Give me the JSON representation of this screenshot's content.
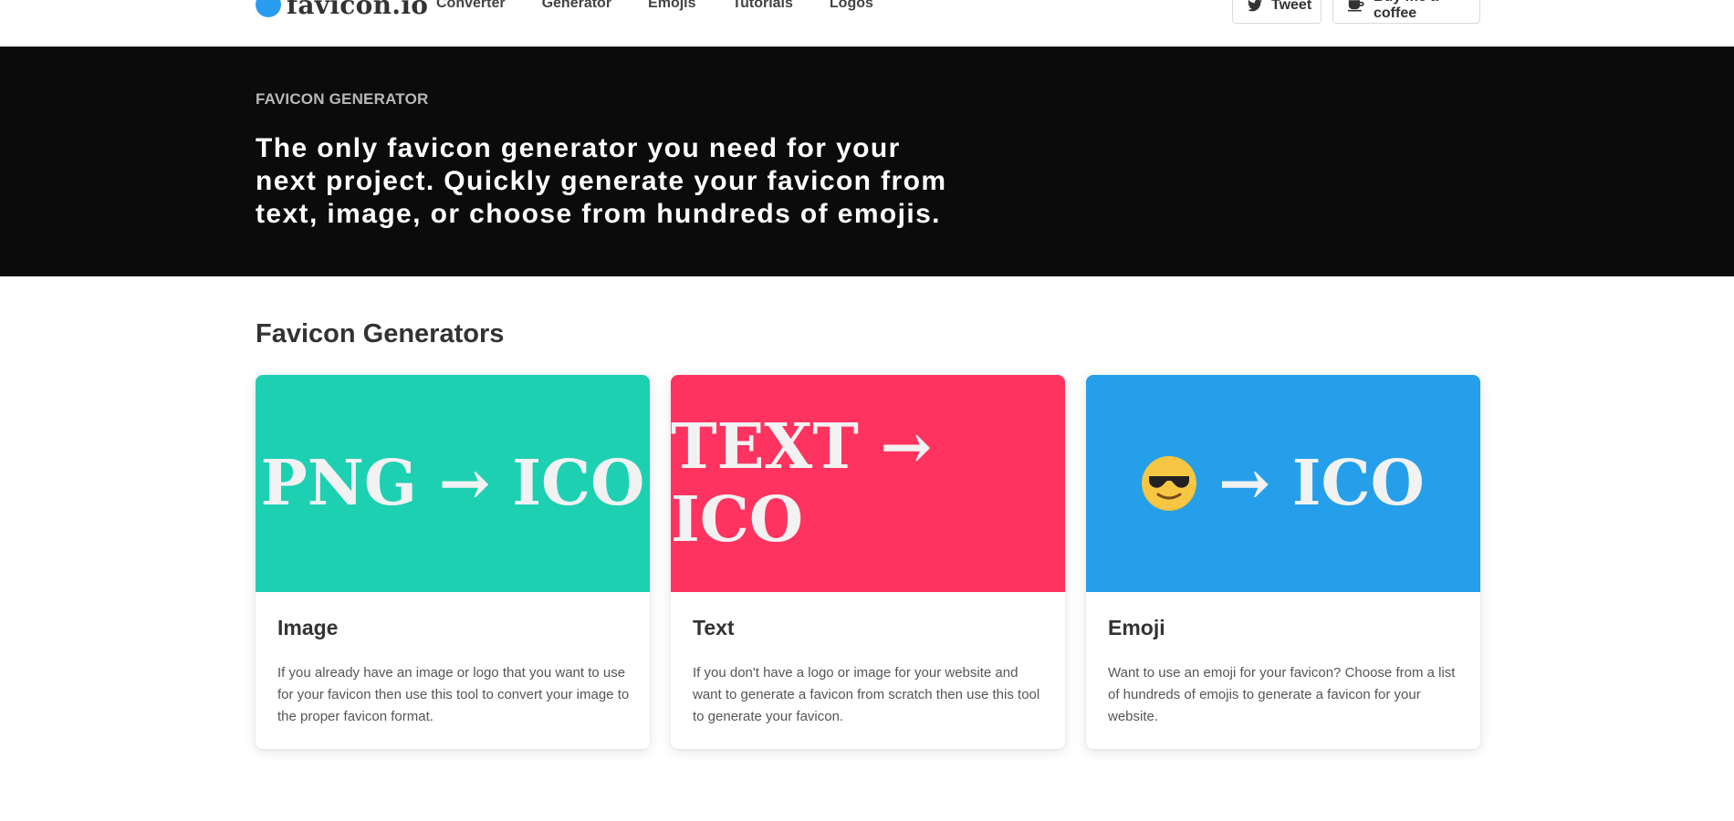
{
  "brand": {
    "name": "favicon.io",
    "color": "#2b9df0"
  },
  "nav": {
    "links": [
      "Converter",
      "Generator",
      "Emojis",
      "Tutorials",
      "Logos"
    ],
    "tweet_label": "Tweet",
    "coffee_label": "Buy me a coffee"
  },
  "hero": {
    "eyebrow": "FAVICON GENERATOR",
    "headline": "The only favicon generator you need for your next project. Quickly generate your favicon from text, image, or choose from hundreds of emojis."
  },
  "section": {
    "title": "Favicon Generators"
  },
  "cards": [
    {
      "image_text": "PNG → ICO",
      "color": "#1dd0b2",
      "title": "Image",
      "description": "If you already have an image or logo that you want to use for your favicon then use this tool to convert your image to the proper favicon format."
    },
    {
      "image_text": "TEXT → ICO",
      "color": "#fe335f",
      "title": "Text",
      "description": "If you don't have a logo or image for your website and want to generate a favicon from scratch then use this tool to generate your favicon."
    },
    {
      "image_text": "→ ICO",
      "emoji_icon": "sunglasses-face-emoji",
      "color": "#259fe9",
      "title": "Emoji",
      "description": "Want to use an emoji for your favicon? Choose from a list of hundreds of emojis to generate a favicon for your website."
    }
  ]
}
